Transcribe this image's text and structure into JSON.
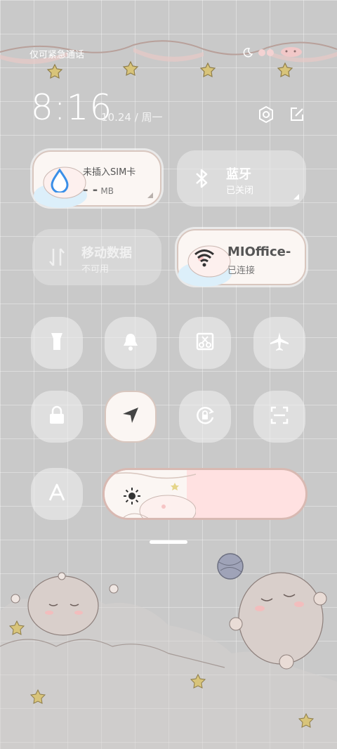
{
  "status_bar": {
    "carrier": "仅可紧急通话",
    "icons": [
      "moon-icon",
      "sticker-icon",
      "battery-icon"
    ]
  },
  "header": {
    "time": "8:16",
    "date": "10.24 / 周一",
    "icons": [
      "settings-icon",
      "edit-icon"
    ]
  },
  "big_tiles": [
    {
      "id": "mobile-data-usage",
      "title": "未插入SIM卡",
      "sub_value": "- -",
      "sub_unit": "MB",
      "icon": "water-drop-icon",
      "active": true
    },
    {
      "id": "bluetooth",
      "title": "蓝牙",
      "sub": "已关闭",
      "icon": "bluetooth-icon",
      "active": false
    },
    {
      "id": "mobile-data",
      "title": "移动数据",
      "sub": "不可用",
      "icon": "data-arrows-icon",
      "active": false,
      "disabled": true
    },
    {
      "id": "wifi",
      "title": "MIOffice-",
      "sub": "已连接",
      "icon": "wifi-icon",
      "active": true
    }
  ],
  "small_tiles": [
    {
      "id": "flashlight",
      "icon": "flashlight-icon",
      "active": false
    },
    {
      "id": "ringer",
      "icon": "bell-icon",
      "active": false
    },
    {
      "id": "screenshot",
      "icon": "screenshot-scissors-icon",
      "active": false
    },
    {
      "id": "airplane",
      "icon": "airplane-icon",
      "active": false
    },
    {
      "id": "lock-screen",
      "icon": "lock-icon",
      "active": false
    },
    {
      "id": "location",
      "icon": "location-arrow-icon",
      "active": true
    },
    {
      "id": "rotation-lock",
      "icon": "rotation-lock-icon",
      "active": false
    },
    {
      "id": "scanner",
      "icon": "scan-icon",
      "active": false
    },
    {
      "id": "font-size",
      "icon": "font-a-icon",
      "active": false
    }
  ],
  "brightness": {
    "level_fraction": 0.41,
    "icon": "sun-icon"
  },
  "colors": {
    "accent_pink": "#ffe1e1",
    "tile_cream": "#fbf6f3",
    "outline": "#d8c6be",
    "drop_blue": "#3a8fe8"
  }
}
